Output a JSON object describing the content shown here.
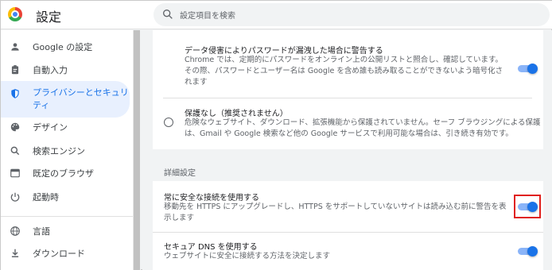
{
  "header": {
    "title": "設定",
    "search_placeholder": "設定項目を検索"
  },
  "sidebar": {
    "items": [
      {
        "label": "Google の設定",
        "icon": "person-icon"
      },
      {
        "label": "自動入力",
        "icon": "clipboard-icon"
      },
      {
        "label": "プライバシーとセキュリ",
        "label2": "ティ",
        "icon": "shield-icon",
        "active": true
      },
      {
        "label": "デザイン",
        "icon": "palette-icon"
      },
      {
        "label": "検索エンジン",
        "icon": "search-icon"
      },
      {
        "label": "既定のブラウザ",
        "icon": "browser-icon"
      },
      {
        "label": "起動時",
        "icon": "power-icon"
      },
      {
        "label": "言語",
        "icon": "globe-icon"
      },
      {
        "label": "ダウンロード",
        "icon": "download-icon"
      }
    ]
  },
  "main": {
    "breach_warning": {
      "title": "データ侵害によりパスワードが漏洩した場合に警告する",
      "desc1": "Chrome では、定期的にパスワードをオンライン上の公開リストと照合し、確認しています。",
      "desc2": "その際、パスワードとユーザー名は Google を含め誰も読み取ることができないよう暗号化さ",
      "desc3": "れます",
      "enabled": true
    },
    "no_protection": {
      "title": "保護なし（推奨されません）",
      "desc1": "危険なウェブサイト、ダウンロード、拡張機能から保護されていません。セーフ ブラウジングによる保護",
      "desc2": "は、Gmail や Google 検索など他の Google サービスで利用可能な場合は、引き続き有効です。",
      "selected": false
    },
    "advanced_label": "詳細設定",
    "https_always": {
      "title": "常に安全な接続を使用する",
      "desc1": "移動先を HTTPS にアップグレードし、HTTPS をサポートしていないサイトは読み込む前に警告を表",
      "desc2": "示します",
      "enabled": true
    },
    "secure_dns": {
      "title": "セキュア DNS を使用する",
      "desc1": "ウェブサイトに安全に接続する方法を決定します",
      "enabled": true
    }
  },
  "colors": {
    "accent": "#1a73e8",
    "highlight": "#e0201c",
    "active_bg": "#e8f0fe"
  }
}
